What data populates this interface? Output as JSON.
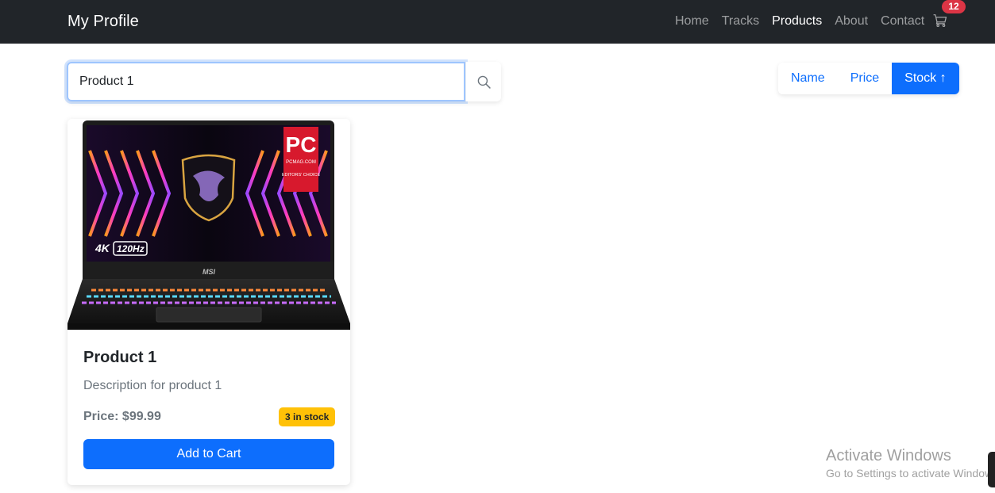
{
  "navbar": {
    "brand": "My Profile",
    "links": [
      {
        "label": "Home",
        "active": false
      },
      {
        "label": "Tracks",
        "active": false
      },
      {
        "label": "Products",
        "active": true
      },
      {
        "label": "About",
        "active": false
      },
      {
        "label": "Contact",
        "active": false
      }
    ],
    "cart_icon": "cart-icon",
    "cart_count": "12"
  },
  "search": {
    "value": "Product 1",
    "icon": "search-icon"
  },
  "sort": {
    "buttons": [
      {
        "label": "Name",
        "active": false
      },
      {
        "label": "Price",
        "active": false
      },
      {
        "label": "Stock ↑",
        "active": true
      }
    ]
  },
  "products": [
    {
      "image_text": {
        "badge_top": "PC",
        "badge_mid": "PCMAG.COM",
        "badge_bottom": "EDITORS' CHOICE",
        "res": "4K",
        "hz": "120Hz",
        "brand": "MSI"
      },
      "title": "Product 1",
      "description": "Description for product 1",
      "price": "Price: $99.99",
      "stock": "3 in stock",
      "add_label": "Add to Cart"
    }
  ],
  "watermark": {
    "title": "Activate Windows",
    "subtitle": "Go to Settings to activate Windows."
  },
  "colors": {
    "navbar": "#212529",
    "primary": "#0d6efd",
    "warning": "#ffc107",
    "danger": "#dc3545"
  }
}
